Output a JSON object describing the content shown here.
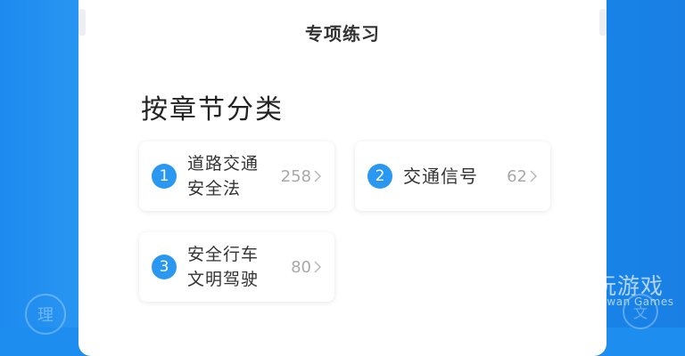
{
  "header": {
    "title": "专项练习"
  },
  "section": {
    "title": "按章节分类"
  },
  "categories": [
    {
      "number": "1",
      "label_line1": "道路交通",
      "label_line2": "安全法",
      "count": "258"
    },
    {
      "number": "2",
      "label_line1": "交通信号",
      "label_line2": "",
      "count": "62"
    },
    {
      "number": "3",
      "label_line1": "安全行车",
      "label_line2": "文明驾驶",
      "count": "80"
    }
  ],
  "decorations": {
    "left_badge": "理",
    "right_badge": "文"
  },
  "watermark": {
    "brand_cn": "仍玩游戏",
    "brand_en": "Rengwan Games"
  },
  "colors": {
    "accent": "#2A97F1",
    "background": "#1E8DF0",
    "count_text": "#A8A8A8"
  }
}
